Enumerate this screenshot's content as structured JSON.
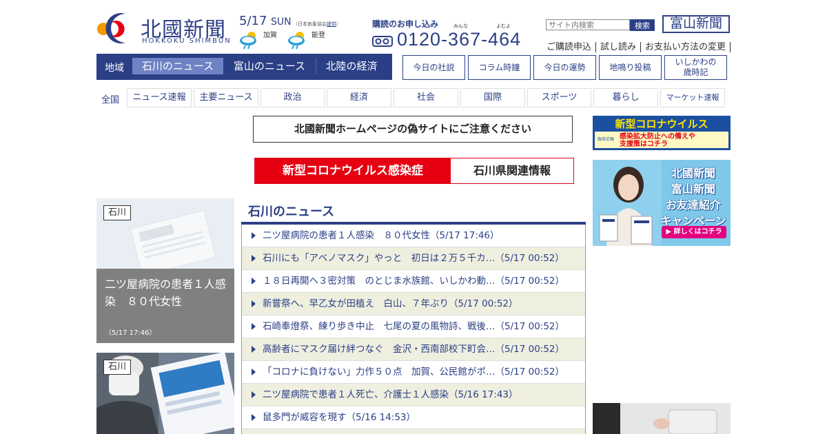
{
  "header": {
    "logo_title": "北國新聞",
    "logo_sub": "HOKKOKU SHIMBUN",
    "weather": {
      "date": "5/17",
      "day": "SUN",
      "note_prefix": "（日本気象協会",
      "note_link": "提供",
      "note_suffix": "）",
      "loc1": "加賀",
      "loc2": "能登"
    },
    "subscribe": {
      "label": "購読のお申し込み",
      "ruby1": "みんな",
      "ruby2": "よむよ",
      "phone": "0120-367-464"
    },
    "search": {
      "placeholder": "サイト内検索",
      "button": "検索"
    },
    "toyama_button": "富山新聞",
    "links": [
      "ご購読申込",
      "試し読み",
      "お支払い方法の変更"
    ]
  },
  "region_nav": {
    "label": "地域",
    "tabs": [
      "石川のニュース",
      "富山のニュース",
      "北陸の経済"
    ]
  },
  "top_buttons": [
    "今日の社説",
    "コラム時鐘",
    "今日の運勢",
    "地鳴り投稿",
    "いしかわの",
    "歳時記"
  ],
  "category_nav": {
    "label": "全国",
    "items": [
      "ニュース速報",
      "主要ニュース",
      "政治",
      "経済",
      "社会",
      "国際",
      "スポーツ",
      "暮らし",
      "マーケット速報"
    ]
  },
  "banners": {
    "warning": "北國新聞ホームページの偽サイトにご注意ください",
    "covid_left": "新型コロナウイルス感染症",
    "covid_right": "石川県関連情報"
  },
  "ads": {
    "ad1_top": "新型コロナウイルス",
    "ad1_line1": "感染拡大防止への備えや",
    "ad1_line2": "支援策はコチラ",
    "ad1_logo": "政府広報",
    "ad2_lines": [
      "北國新聞",
      "富山新聞",
      "お友達紹介",
      "キャンペーン"
    ],
    "ad2_button": "▶ 詳しくはコチラ"
  },
  "cards": [
    {
      "tag": "石川",
      "title": "二ツ屋病院の患者１人感染　８０代女性",
      "time": "（5/17 17:46）"
    },
    {
      "tag": "石川"
    }
  ],
  "section_title": "石川のニュース",
  "news": [
    "二ツ屋病院の患者１人感染　８０代女性（5/17 17:46）",
    "石川にも「アベノマスク」やっと　初日は２万５千カ…（5/17 00:52）",
    "１８日再開へ３密対策　のとじま水族館、いしかわ動…（5/17 00:52）",
    "新嘗祭へ、早乙女が田植え　白山、７年ぶり（5/17 00:52）",
    "石崎奉燈祭、練り歩き中止　七尾の夏の風物詩、戦後…（5/17 00:52）",
    "高齢者にマスク届け絆つなぐ　金沢・西南部校下町会…（5/17 00:52）",
    "「コロナに負けない」力作５０点　加賀、公民館がポ…（5/17 00:52）",
    "二ツ屋病院で患者１人死亡、介護士１人感染（5/16 17:43）",
    "鼠多門が威容を現す（5/16 14:53）"
  ],
  "colors": {
    "brand": "#2b3f86",
    "accent_red": "#e60012",
    "row_alt": "#efefdf"
  }
}
